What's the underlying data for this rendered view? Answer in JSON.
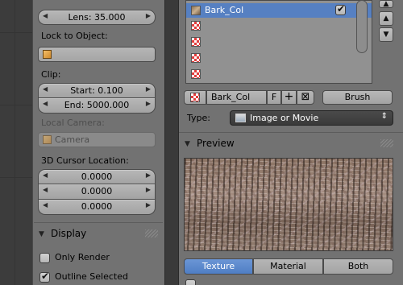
{
  "left_panel": {
    "lens_field": "Lens: 35.000",
    "lock_label": "Lock to Object:",
    "clip_label": "Clip:",
    "clip_start": "Start: 0.100",
    "clip_end": "End: 5000.000",
    "local_camera_label": "Local Camera:",
    "camera_placeholder": "Camera",
    "cursor_label": "3D Cursor Location:",
    "cursor_values": [
      "0.0000",
      "0.0000",
      "0.0000"
    ],
    "display_header": "Display",
    "only_render": {
      "label": "Only Render",
      "checked": false
    },
    "outline_selected": {
      "label": "Outline Selected",
      "checked": true
    }
  },
  "texture_panel": {
    "slots": [
      {
        "name": "Bark_Col",
        "selected": true,
        "enabled": true
      },
      {
        "name": "",
        "selected": false
      },
      {
        "name": "",
        "selected": false
      },
      {
        "name": "",
        "selected": false
      },
      {
        "name": "",
        "selected": false
      }
    ],
    "texture_name": "Bark_Col",
    "fake_user_label": "F",
    "brush_label": "Brush",
    "type_label": "Type:",
    "type_value": "Image or Movie",
    "preview_header": "Preview",
    "preview_tabs": [
      "Texture",
      "Material",
      "Both"
    ],
    "active_tab": "Texture"
  },
  "colors": {
    "panel_bg": "#727272",
    "selection": "#5680c2",
    "dropdown_bg": "#3a3a3a"
  }
}
